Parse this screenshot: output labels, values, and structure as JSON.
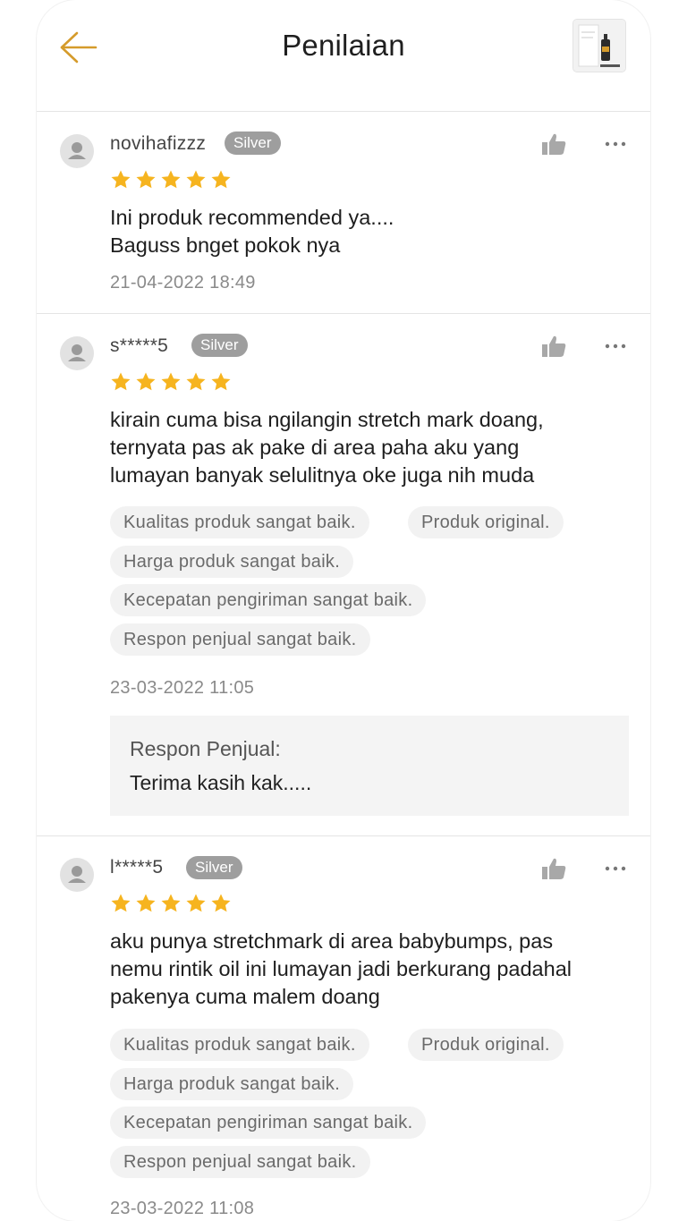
{
  "header": {
    "title": "Penilaian",
    "back_icon": "arrow-left-icon",
    "accent_color": "#d59b2b",
    "product_thumbnail": "product-thumbnail"
  },
  "star_color": "#f6b41f",
  "reviews": [
    {
      "username": "novihafizzz",
      "badge": "Silver",
      "rating": 5,
      "comment": "Ini produk recommended ya....\nBaguss bnget pokok nya",
      "tags": [],
      "date": "21-04-2022 18:49",
      "seller_response": null
    },
    {
      "username": "s*****5",
      "badge": "Silver",
      "rating": 5,
      "comment": "kirain cuma bisa ngilangin stretch mark doang,\nternyata pas ak pake di area paha aku yang\nlumayan banyak selulitnya oke juga nih muda",
      "tags": [
        "Kualitas produk sangat baik.",
        "Produk original.",
        "Harga produk sangat baik.",
        "Kecepatan pengiriman sangat baik.",
        "Respon penjual sangat baik."
      ],
      "date": "23-03-2022 11:05",
      "seller_response": {
        "title": "Respon Penjual:",
        "text": "Terima kasih kak....."
      }
    },
    {
      "username": "l*****5",
      "badge": "Silver",
      "rating": 5,
      "comment": "aku punya stretchmark di area babybumps, pas\nnemu rintik oil ini lumayan jadi berkurang padahal\npakenya cuma malem doang",
      "tags": [
        "Kualitas produk sangat baik.",
        "Produk original.",
        "Harga produk sangat baik.",
        "Kecepatan pengiriman sangat baik.",
        "Respon penjual sangat baik."
      ],
      "date": "23-03-2022 11:08",
      "seller_response": null
    }
  ]
}
